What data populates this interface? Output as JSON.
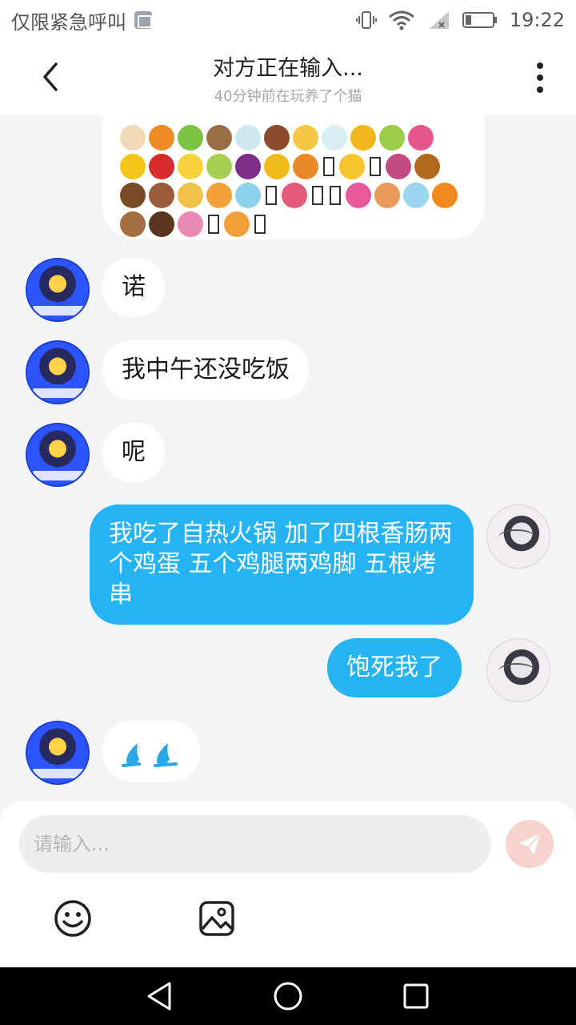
{
  "status_bar": {
    "carrier": "仅限紧急呼叫",
    "time": "19:22",
    "icons": [
      "vibrate-icon",
      "wifi-icon",
      "signal-icon",
      "battery-icon"
    ]
  },
  "header": {
    "title": "对方正在输入...",
    "subtitle": "40分钟前在玩养了个猫"
  },
  "messages": [
    {
      "side": "in",
      "text": "诺"
    },
    {
      "side": "in",
      "text": "我中午还没吃饭"
    },
    {
      "side": "in",
      "text": "呢"
    },
    {
      "side": "out",
      "text": "我吃了自热火锅 加了四根香肠两个鸡蛋 五个鸡腿两鸡脚 五根烤串"
    },
    {
      "side": "out",
      "text": "饱死我了"
    }
  ],
  "input": {
    "placeholder": "请输入..."
  },
  "colors": {
    "out_bubble": "#25b3f4",
    "send_button": "#f8d2cc",
    "background": "#f3f4f6"
  }
}
